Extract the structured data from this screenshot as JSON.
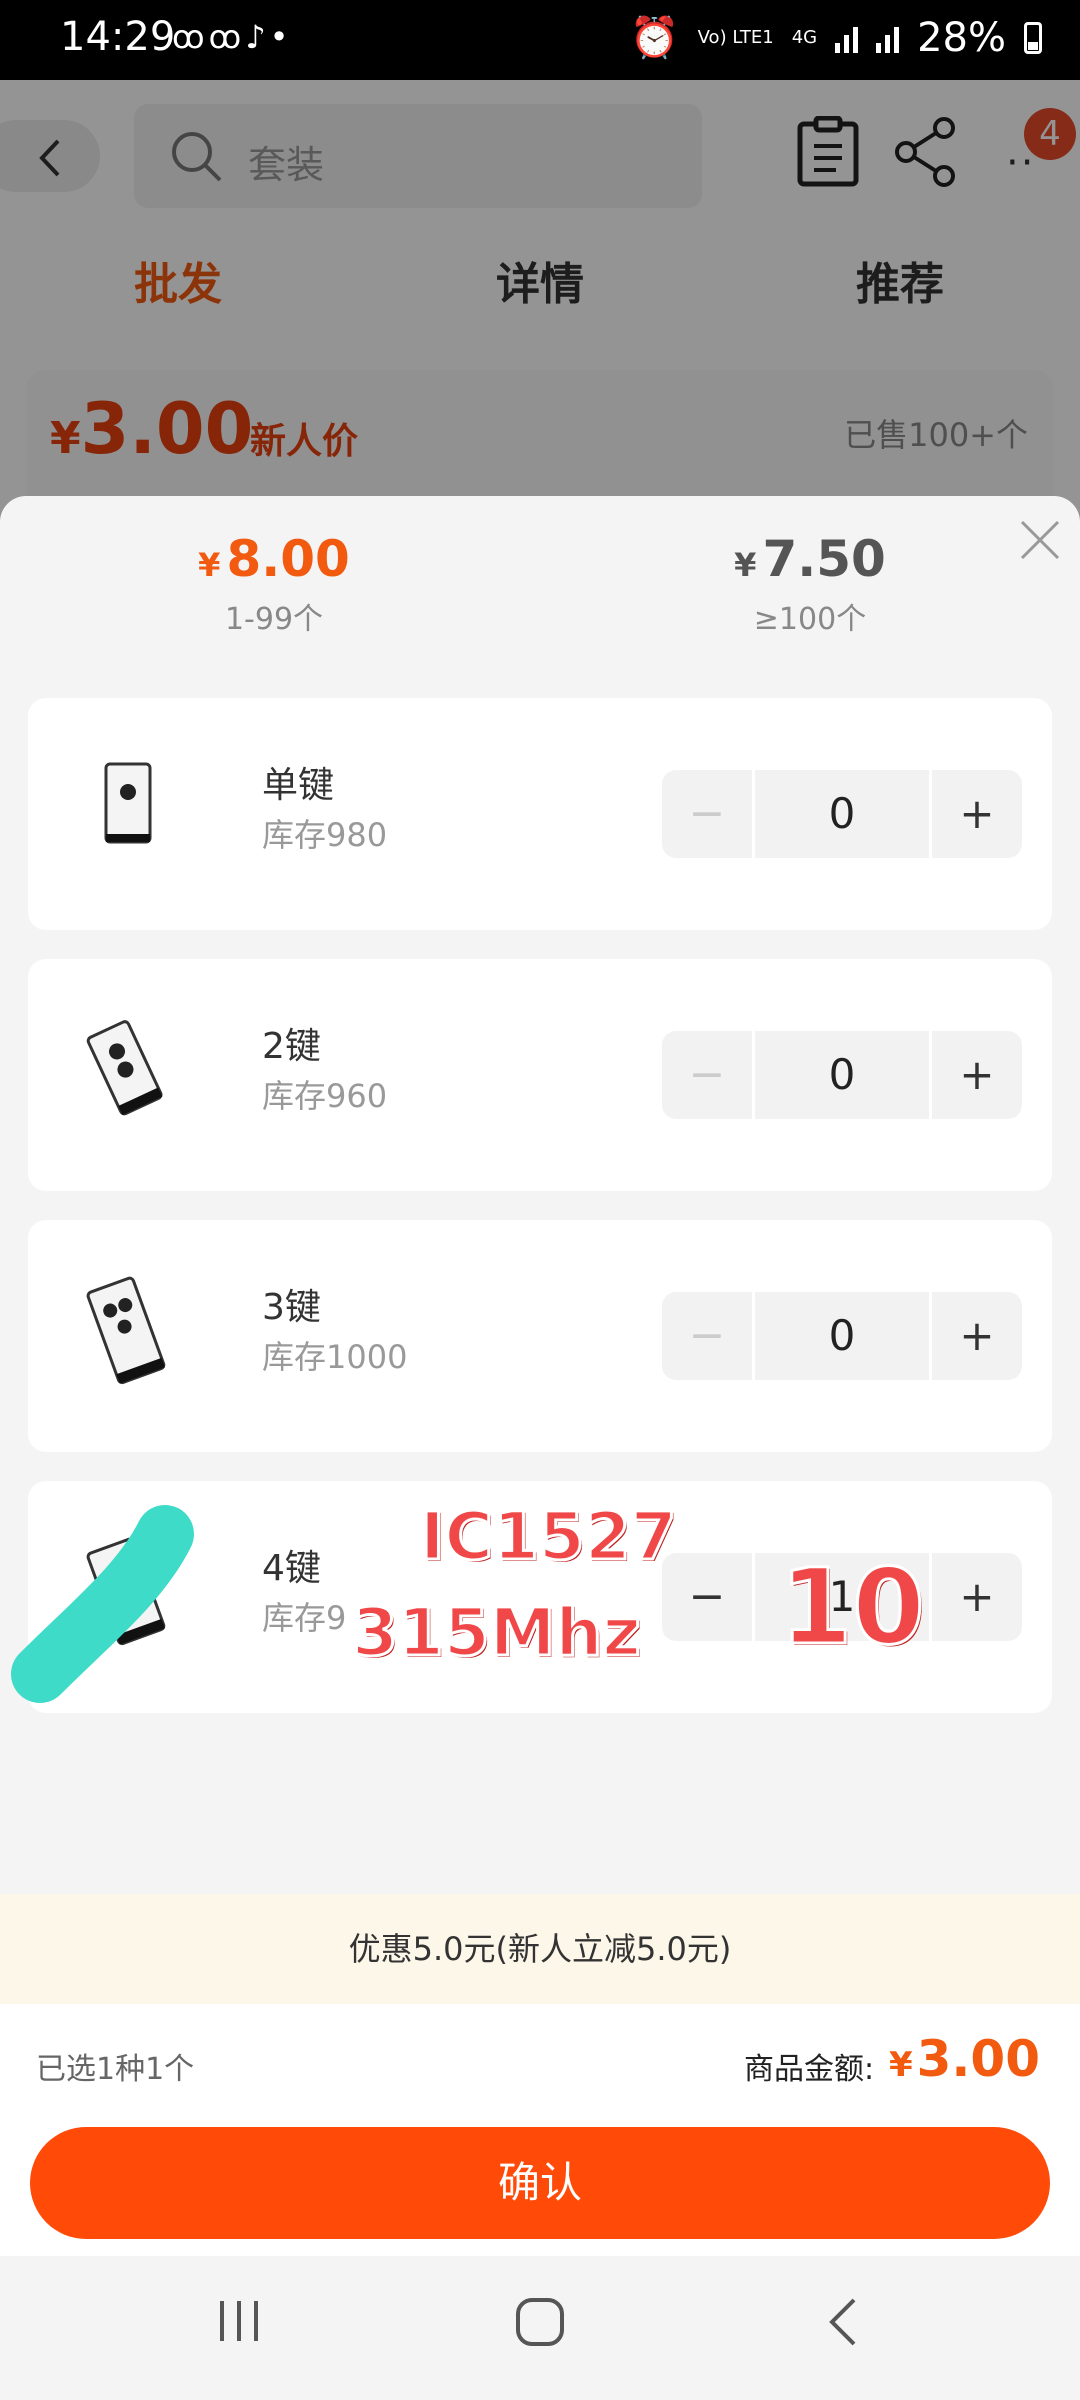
{
  "status_bar": {
    "time": "14:29",
    "network_top": "Vo) LTE1",
    "network_4g": "4G",
    "battery": "28%"
  },
  "header": {
    "search_placeholder": "套装",
    "badge_count": "4"
  },
  "tabs": [
    {
      "label": "批发",
      "active": true
    },
    {
      "label": "详情",
      "active": false
    },
    {
      "label": "推荐",
      "active": false
    }
  ],
  "background_price": {
    "currency": "¥",
    "price": "3.00",
    "tag": "新人价",
    "sold": "已售100+个"
  },
  "price_tiers": [
    {
      "currency": "¥",
      "price": "8.00",
      "range": "1-99个"
    },
    {
      "currency": "¥",
      "price": "7.50",
      "range": "≥100个"
    }
  ],
  "items": [
    {
      "name": "单键",
      "stock": "库存980",
      "qty": "0",
      "minus_enabled": false
    },
    {
      "name": "2键",
      "stock": "库存960",
      "qty": "0",
      "minus_enabled": false
    },
    {
      "name": "3键",
      "stock": "库存1000",
      "qty": "0",
      "minus_enabled": false
    },
    {
      "name": "4键",
      "stock": "库存9",
      "qty": "1",
      "minus_enabled": true
    }
  ],
  "stepper": {
    "minus": "−",
    "plus": "+"
  },
  "annotations": {
    "line1": "IC1527",
    "line2": "315Mhz",
    "qty_note": "10"
  },
  "promo": "优惠5.0元(新人立减5.0元)",
  "summary": {
    "selected": "已选1种1个",
    "amount_label": "商品金额:",
    "currency": "¥",
    "amount": "3.00"
  },
  "confirm_label": "确认",
  "colors": {
    "accent": "#f25a10",
    "confirm": "#ff4a08",
    "promo_bg": "#fdf7ea"
  }
}
